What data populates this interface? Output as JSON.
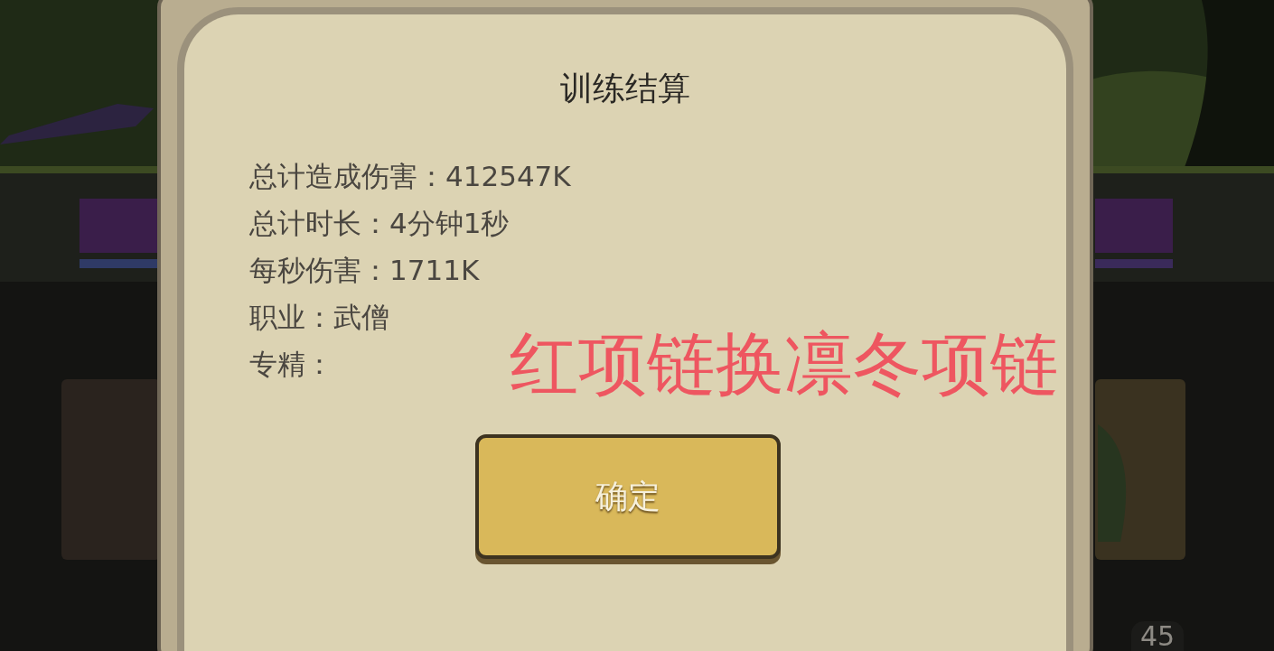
{
  "background": {
    "kind": "picture",
    "count_badge": "45"
  },
  "dialog": {
    "title": "训练结算",
    "stats": [
      "总计造成伤害：412547K",
      "总计时长：4分钟1秒",
      "每秒伤害：1711K",
      "职业：武僧",
      "专精："
    ],
    "annotation": "红项链换凛冬项链",
    "button": "确定"
  }
}
